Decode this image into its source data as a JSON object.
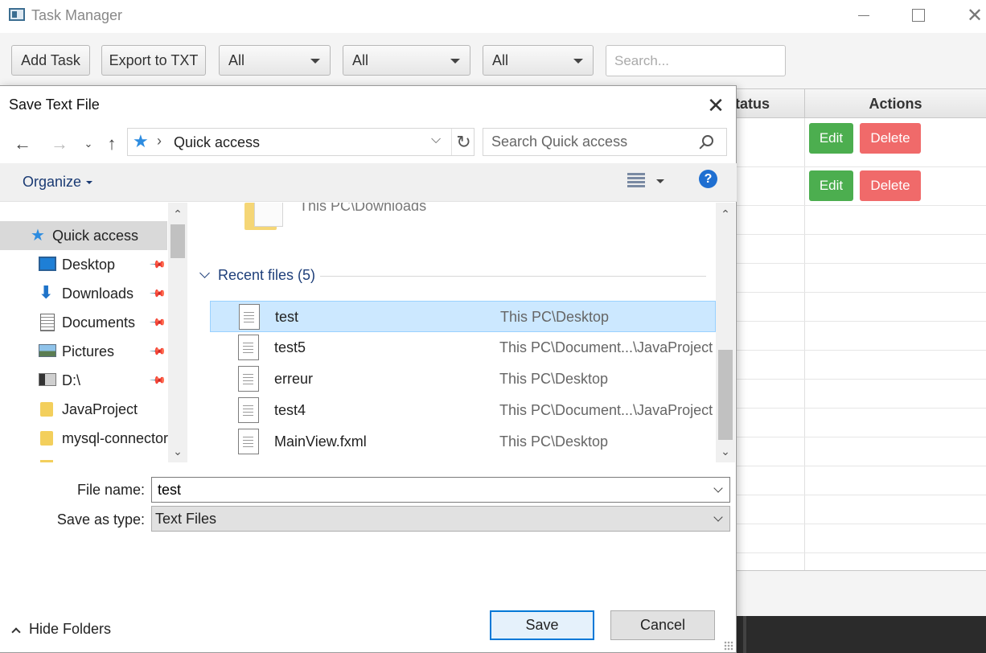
{
  "app": {
    "title": "Task Manager",
    "toolbar": {
      "add_task": "Add Task",
      "export": "Export to TXT",
      "filter1": "All",
      "filter2": "All",
      "filter3": "All",
      "search_placeholder": "Search..."
    },
    "table": {
      "col_status": "Status",
      "col_actions": "Actions",
      "rows": [
        {
          "edit": "Edit",
          "delete": "Delete"
        },
        {
          "edit": "Edit",
          "delete": "Delete"
        }
      ]
    }
  },
  "dialog": {
    "title": "Save Text File",
    "address": {
      "location": "Quick access"
    },
    "search_placeholder": "Search Quick access",
    "organize": "Organize",
    "help": "?",
    "nav": [
      {
        "label": "Quick access",
        "icon": "star-icon",
        "pinned": false
      },
      {
        "label": "Desktop",
        "icon": "desktop-icon",
        "pinned": true
      },
      {
        "label": "Downloads",
        "icon": "download-icon",
        "pinned": true
      },
      {
        "label": "Documents",
        "icon": "documents-icon",
        "pinned": true
      },
      {
        "label": "Pictures",
        "icon": "pictures-icon",
        "pinned": true
      },
      {
        "label": "D:\\",
        "icon": "drive-icon",
        "pinned": true
      },
      {
        "label": "JavaProject",
        "icon": "folder-icon",
        "pinned": false
      },
      {
        "label": "mysql-connector",
        "icon": "folder-icon",
        "pinned": false
      }
    ],
    "top_item": {
      "path": "This PC\\Downloads"
    },
    "recent": {
      "header": "Recent files (5)",
      "files": [
        {
          "name": "test",
          "path": "This PC\\Desktop",
          "selected": true
        },
        {
          "name": "test5",
          "path": "This PC\\Document...\\JavaProject",
          "selected": false
        },
        {
          "name": "erreur",
          "path": "This PC\\Desktop",
          "selected": false
        },
        {
          "name": "test4",
          "path": "This PC\\Document...\\JavaProject",
          "selected": false
        },
        {
          "name": "MainView.fxml",
          "path": "This PC\\Desktop",
          "selected": false
        }
      ]
    },
    "file_name_label": "File name:",
    "file_name_value": "test",
    "save_type_label": "Save as type:",
    "save_type_value": "Text Files",
    "hide_folders": "Hide Folders",
    "save": "Save",
    "cancel": "Cancel"
  }
}
